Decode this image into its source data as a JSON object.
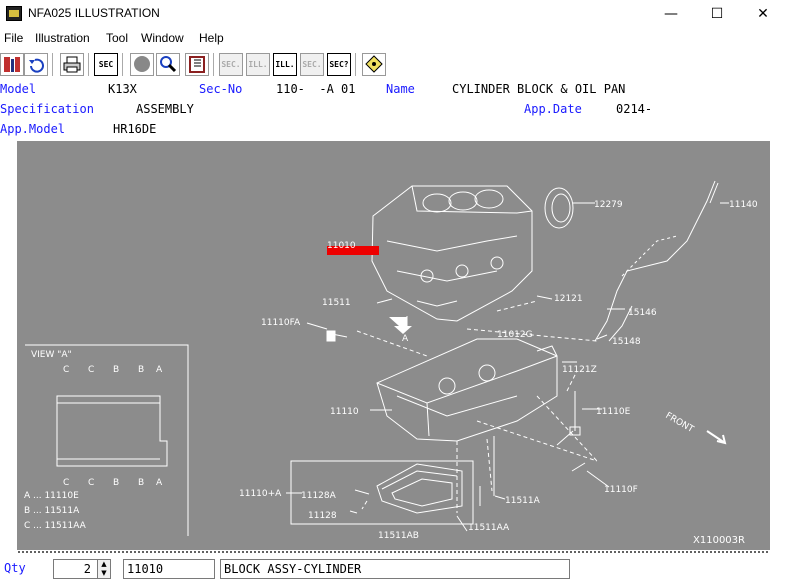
{
  "window": {
    "title": "NFA025 ILLUSTRATION",
    "minimize": "—",
    "maximize": "☐",
    "close": "✕"
  },
  "menu": [
    "File",
    "Illustration",
    "Tool",
    "Window",
    "Help"
  ],
  "toolbar": {
    "buttons": [
      {
        "icon": "parts-catalog-icon"
      },
      {
        "icon": "undo-icon"
      },
      {
        "icon": "print-icon"
      },
      {
        "label": "SEC"
      },
      {
        "icon": "circle-icon"
      },
      {
        "icon": "zoom-search-icon"
      },
      {
        "icon": "book-icon"
      },
      {
        "label": "SEC."
      },
      {
        "label": "ILL."
      },
      {
        "label": "ILL."
      },
      {
        "label": "SEC."
      },
      {
        "label": "SEC?"
      },
      {
        "icon": "tag-icon"
      }
    ]
  },
  "info": {
    "model_label": "Model",
    "model_value": "K13X",
    "sec_label": "Sec-No",
    "sec_value": "110-  -A 01",
    "name_label": "Name",
    "name_value": "CYLINDER BLOCK & OIL PAN",
    "spec_label": "Specification",
    "spec_value": "ASSEMBLY",
    "appdate_label": "App.Date",
    "appdate_value": "0214-",
    "appmodel_label": "App.Model",
    "appmodel_value": "HR16DE"
  },
  "illustration": {
    "callouts": {
      "c12279": "12279",
      "c11140": "11140",
      "c11010": "11010",
      "c11511": "11511",
      "c12121": "12121",
      "c15146": "15146",
      "c11110fa": "11110FA",
      "c11012g": "11012G",
      "c15148": "15148",
      "c11121z": "11121Z",
      "c11110": "11110",
      "c11110e": "11110E",
      "c11110f": "11110F",
      "c11110a": "11110+A",
      "c11128a": "11128A",
      "c11128": "11128",
      "c11511a": "11511A",
      "c11511aa": "11511AA",
      "c11511ab": "11511AB",
      "arrow_a": "A",
      "front": "FRONT",
      "figure_id": "X110003R"
    },
    "view_a": {
      "title": "VIEW \"A\"",
      "top_letters": [
        "C",
        "C",
        "B",
        "B",
        "A"
      ],
      "bottom_letters": [
        "C",
        "C",
        "B",
        "B",
        "A"
      ],
      "legend": [
        "A ... 11110E",
        "B ... 11511A",
        "C ... 11511AA"
      ]
    }
  },
  "status": {
    "qty_label": "Qty",
    "qty_value": "2",
    "part_no": "11010",
    "part_name": "BLOCK ASSY-CYLINDER"
  }
}
